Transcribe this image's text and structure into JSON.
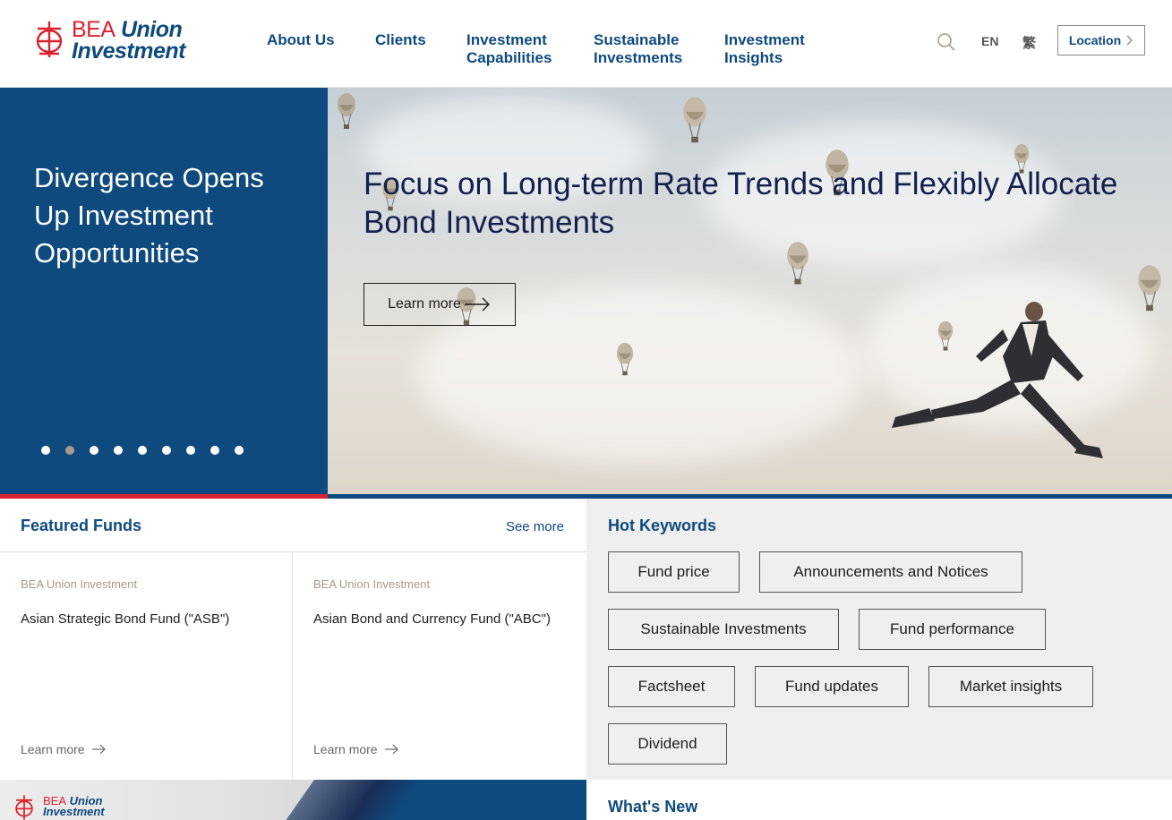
{
  "header": {
    "logo": {
      "line1_a": "BEA",
      "line1_b": "Union",
      "line2": "Investment"
    },
    "nav": [
      {
        "line1": "About Us",
        "line2": ""
      },
      {
        "line1": "Clients",
        "line2": ""
      },
      {
        "line1": "Investment",
        "line2": "Capabilities"
      },
      {
        "line1": "Sustainable",
        "line2": "Investments"
      },
      {
        "line1": "Investment",
        "line2": "Insights"
      }
    ],
    "lang_en": "EN",
    "lang_tc": "繁",
    "location_label": "Location",
    "icons": {
      "search": "search-icon",
      "location_chevron": "chevron-right-icon"
    }
  },
  "hero": {
    "side_title": "Divergence Opens Up Investment Opportunities",
    "title": "Focus on Long-term Rate Trends and Flexibly Allocate Bond Investments",
    "button_label": "Learn more",
    "slide_count": 9,
    "active_slide": 2
  },
  "featured": {
    "title": "Featured Funds",
    "see_more": "See more",
    "funds": [
      {
        "brand": "BEA Union Investment",
        "name": "Asian Strategic Bond Fund (\"ASB\")",
        "learn_more": "Learn more"
      },
      {
        "brand": "BEA Union Investment",
        "name": "Asian Bond and Currency Fund (\"ABC\")",
        "learn_more": "Learn more"
      }
    ]
  },
  "hot_keywords": {
    "title": "Hot Keywords",
    "items": [
      "Fund price",
      "Announcements and Notices",
      "Sustainable Investments",
      "Fund performance",
      "Factsheet",
      "Fund updates",
      "Market insights",
      "Dividend"
    ]
  },
  "bottom": {
    "mini_logo": {
      "line1_a": "BEA",
      "line1_b": "Union",
      "line2": "Investment"
    },
    "whats_new": "What's New"
  },
  "colors": {
    "brand_blue": "#0e4a7e",
    "brand_red": "#d9232e",
    "accent_taupe": "#a8998a"
  }
}
